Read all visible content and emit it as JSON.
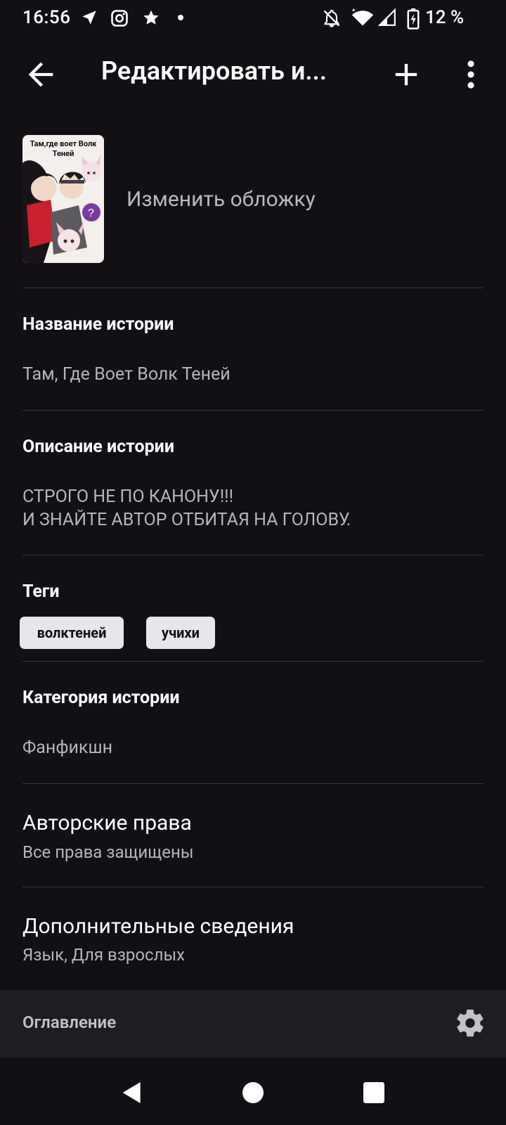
{
  "status_bar": {
    "time": "16:56",
    "battery": "12 %",
    "left_icons": [
      "navigation-icon",
      "instagram-icon",
      "star-icon",
      "dot-icon"
    ],
    "right_icons": [
      "notifications-off-icon",
      "wifi-icon",
      "signal-icon",
      "battery-charging-icon"
    ]
  },
  "toolbar": {
    "title": "Редактировать и..."
  },
  "cover": {
    "caption": "Там,где воет Волк Теней",
    "change_label": "Изменить обложку"
  },
  "story_title": {
    "label": "Название истории",
    "value": "Там, Где Воет Волк Теней"
  },
  "description": {
    "label": "Описание истории",
    "line1": "СТРОГО НЕ ПО КАНОНУ!!!",
    "line2": "И ЗНАЙТЕ АВТОР ОТБИТАЯ НА ГОЛОВУ."
  },
  "tags": {
    "label": "Теги",
    "items": [
      "волктеней",
      "учихи"
    ]
  },
  "category": {
    "label": "Категория истории",
    "value": "Фанфикшн"
  },
  "copyright": {
    "label": "Авторские права",
    "value": "Все права защищены"
  },
  "additional": {
    "label": "Дополнительные сведения",
    "value": "Язык, Для взрослых"
  },
  "toc": {
    "label": "Оглавление"
  },
  "colors": {
    "background": "#121014",
    "toc_background": "#1f1d22",
    "tag_background": "#e7e6ea",
    "secondary_text": "#b6b5ba"
  }
}
